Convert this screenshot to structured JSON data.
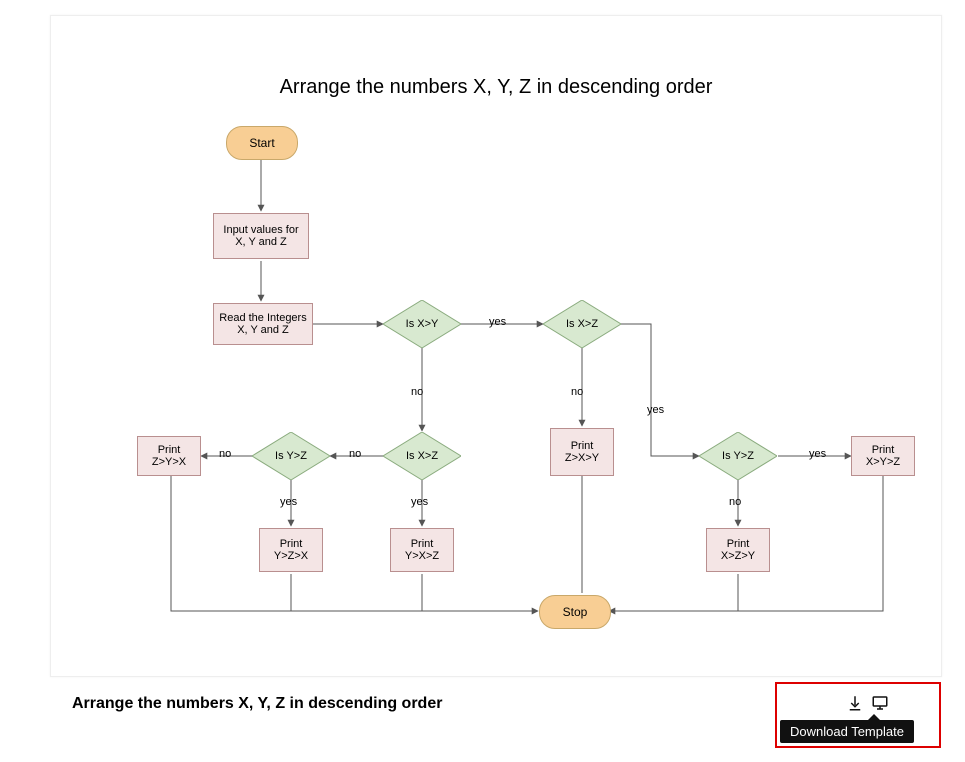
{
  "title": "Arrange the numbers X, Y, Z in descending order",
  "caption": "Arrange the numbers X, Y, Z in descending order",
  "tooltip": "Download Template",
  "nodes": {
    "start": "Start",
    "stop": "Stop",
    "input": "Input values for X, Y and Z",
    "read": "Read the Integers X, Y and Z",
    "d_xy": "Is X>Y",
    "d_xz_top": "Is X>Z",
    "d_xz_mid": "Is X>Z",
    "d_yz_left": "Is Y>Z",
    "d_yz_right": "Is Y>Z",
    "p_zyx": "Print\nZ>Y>X",
    "p_zxy": "Print\nZ>X>Y",
    "p_xyz": "Print\nX>Y>Z",
    "p_yzx": "Print\nY>Z>X",
    "p_yxz": "Print\nY>X>Z",
    "p_xzy": "Print\nX>Z>Y"
  },
  "edges": {
    "yes": "yes",
    "no": "no"
  },
  "chart_data": {
    "type": "flowchart",
    "title": "Arrange the numbers X, Y, Z in descending order",
    "nodes": [
      {
        "id": "start",
        "type": "terminator",
        "label": "Start"
      },
      {
        "id": "input",
        "type": "process",
        "label": "Input values for X, Y and Z"
      },
      {
        "id": "read",
        "type": "process",
        "label": "Read the Integers X, Y and Z"
      },
      {
        "id": "d_xy",
        "type": "decision",
        "label": "Is X>Y"
      },
      {
        "id": "d_xz_top",
        "type": "decision",
        "label": "Is X>Z"
      },
      {
        "id": "d_xz_mid",
        "type": "decision",
        "label": "Is X>Z"
      },
      {
        "id": "d_yz_left",
        "type": "decision",
        "label": "Is Y>Z"
      },
      {
        "id": "d_yz_right",
        "type": "decision",
        "label": "Is Y>Z"
      },
      {
        "id": "p_zyx",
        "type": "process",
        "label": "Print Z>Y>X"
      },
      {
        "id": "p_zxy",
        "type": "process",
        "label": "Print Z>X>Y"
      },
      {
        "id": "p_xyz",
        "type": "process",
        "label": "Print X>Y>Z"
      },
      {
        "id": "p_yzx",
        "type": "process",
        "label": "Print Y>Z>X"
      },
      {
        "id": "p_yxz",
        "type": "process",
        "label": "Print Y>X>Z"
      },
      {
        "id": "p_xzy",
        "type": "process",
        "label": "Print X>Z>Y"
      },
      {
        "id": "stop",
        "type": "terminator",
        "label": "Stop"
      }
    ],
    "edges": [
      {
        "from": "start",
        "to": "input"
      },
      {
        "from": "input",
        "to": "read"
      },
      {
        "from": "read",
        "to": "d_xy"
      },
      {
        "from": "d_xy",
        "to": "d_xz_top",
        "label": "yes"
      },
      {
        "from": "d_xy",
        "to": "d_xz_mid",
        "label": "no"
      },
      {
        "from": "d_xz_top",
        "to": "d_yz_right",
        "label": "yes"
      },
      {
        "from": "d_xz_top",
        "to": "p_zxy",
        "label": "no"
      },
      {
        "from": "d_yz_right",
        "to": "p_xyz",
        "label": "yes"
      },
      {
        "from": "d_yz_right",
        "to": "p_xzy",
        "label": "no"
      },
      {
        "from": "d_xz_mid",
        "to": "p_yxz",
        "label": "yes"
      },
      {
        "from": "d_xz_mid",
        "to": "d_yz_left",
        "label": "no"
      },
      {
        "from": "d_yz_left",
        "to": "p_yzx",
        "label": "yes"
      },
      {
        "from": "d_yz_left",
        "to": "p_zyx",
        "label": "no"
      },
      {
        "from": "p_zyx",
        "to": "stop"
      },
      {
        "from": "p_zxy",
        "to": "stop"
      },
      {
        "from": "p_xyz",
        "to": "stop"
      },
      {
        "from": "p_yzx",
        "to": "stop"
      },
      {
        "from": "p_yxz",
        "to": "stop"
      },
      {
        "from": "p_xzy",
        "to": "stop"
      }
    ]
  }
}
